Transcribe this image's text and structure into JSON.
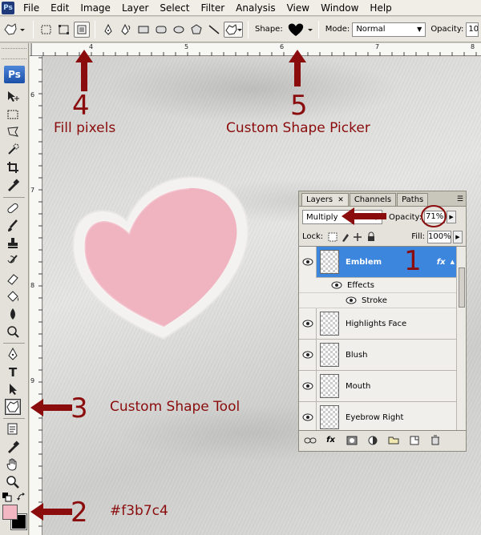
{
  "menu": [
    "File",
    "Edit",
    "Image",
    "Layer",
    "Select",
    "Filter",
    "Analysis",
    "View",
    "Window",
    "Help"
  ],
  "app_icon": "Ps",
  "toolbox_logo": "Ps",
  "options": {
    "shape_label": "Shape:",
    "mode_label": "Mode:",
    "mode_value": "Normal",
    "opacity_label": "Opacity:",
    "opacity_value": "10"
  },
  "rulers": {
    "top": [
      "4",
      "5",
      "6",
      "7",
      "8"
    ],
    "left": [
      "6",
      "7",
      "8",
      "9"
    ]
  },
  "annotations": [
    {
      "num": "4",
      "label": "Fill pixels"
    },
    {
      "num": "5",
      "label": "Custom Shape Picker"
    },
    {
      "num": "1",
      "label": ""
    },
    {
      "num": "3",
      "label": "Custom Shape Tool"
    },
    {
      "num": "2",
      "label": "#f3b7c4"
    }
  ],
  "layers_panel": {
    "tabs": [
      "Layers",
      "Channels",
      "Paths"
    ],
    "blend_mode": "Multiply",
    "opacity_label": "Opacity:",
    "opacity_value": "71%",
    "lock_label": "Lock:",
    "fill_label": "Fill:",
    "fill_value": "100%",
    "layers": [
      {
        "name": "Emblem",
        "selected": true,
        "fx": "fx"
      },
      {
        "name": "Highlights Face"
      },
      {
        "name": "Blush"
      },
      {
        "name": "Mouth"
      },
      {
        "name": "Eyebrow Right"
      }
    ],
    "effects_label": "Effects",
    "stroke_label": "Stroke"
  },
  "colors": {
    "foreground": "#f3b7c4",
    "background": "#000000",
    "annotation": "#8a0c0c",
    "selection": "#3d86dd"
  }
}
